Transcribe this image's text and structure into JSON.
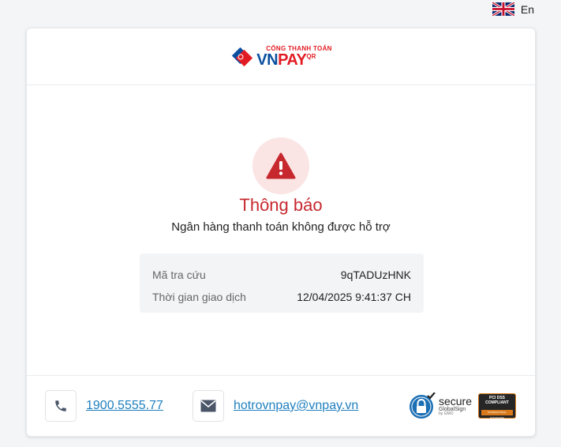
{
  "language": {
    "flag": "uk-flag-icon",
    "label": "En"
  },
  "header": {
    "logo": {
      "top": "CỔNG THANH TOÁN",
      "vn": "VN",
      "pay": "PAY",
      "qr": "QR",
      "brand_blue": "#0a4f9f",
      "brand_red": "#e21b23"
    }
  },
  "notice": {
    "icon": "warning-icon",
    "title": "Thông báo",
    "message": "Ngân hàng thanh toán không được hỗ trợ",
    "accent": "#c6282e"
  },
  "details": {
    "rows": [
      {
        "label": "Mã tra cứu",
        "value": "9qTADUzHNK"
      },
      {
        "label": "Thời gian giao dịch",
        "value": "12/04/2025 9:41:37 CH"
      }
    ]
  },
  "footer": {
    "phone": {
      "icon": "phone-icon",
      "value": "1900.5555.77"
    },
    "email": {
      "icon": "mail-icon",
      "value": "hotrovnpay@vnpay.vn"
    },
    "badges": {
      "secure": {
        "main": "secure",
        "sub": "GlobalSign",
        "sub2": "by GMO"
      },
      "pci": {
        "top": "PCI DSS COMPLIANT",
        "bottom": "INTERNATIONAL STANDARDS"
      }
    },
    "link_color": "#1f7fbf"
  }
}
